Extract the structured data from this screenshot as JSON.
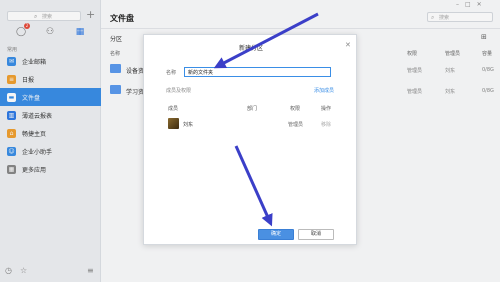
{
  "sidebar": {
    "search_placeholder": "搜索",
    "badge": "2",
    "section_label": "常用",
    "items": [
      {
        "label": "企业邮箱",
        "icon": "mail-icon",
        "color": "#3a8ee6"
      },
      {
        "label": "日报",
        "icon": "report-icon",
        "color": "#f0a030"
      },
      {
        "label": "文件盘",
        "icon": "folder-icon",
        "color": "#3a8ee6",
        "active": true
      },
      {
        "label": "薄道云报表",
        "icon": "chart-icon",
        "color": "#2f7ae5"
      },
      {
        "label": "畅捷主页",
        "icon": "home-icon",
        "color": "#f0a030"
      },
      {
        "label": "企业小助手",
        "icon": "assistant-icon",
        "color": "#3a8ee6"
      },
      {
        "label": "更多应用",
        "icon": "grid-icon",
        "color": "#888888"
      }
    ]
  },
  "main": {
    "title": "文件盘",
    "search_placeholder": "搜索",
    "zone_label": "分区",
    "columns": {
      "name": "名称",
      "perm": "权限",
      "owner": "管理员",
      "size": "容量"
    },
    "rows": [
      {
        "name": "设备资",
        "perm": "管理员",
        "owner": "刘东",
        "size": "0/8G"
      },
      {
        "name": "学习资",
        "perm": "管理员",
        "owner": "刘东",
        "size": "0/8G"
      }
    ]
  },
  "dialog": {
    "title": "新建分区",
    "name_label": "名称",
    "name_value": "新的文件夹",
    "perm_label": "成员及权限",
    "add_member": "添加成员",
    "columns": {
      "member": "成员",
      "dept": "部门",
      "perm": "权限",
      "op": "操作"
    },
    "member": {
      "name": "刘东",
      "perm": "管理员",
      "op": "移除"
    },
    "ok": "确定",
    "cancel": "取消"
  },
  "colors": {
    "accent": "#3a8ee6",
    "arrow": "#3b3fc8"
  }
}
